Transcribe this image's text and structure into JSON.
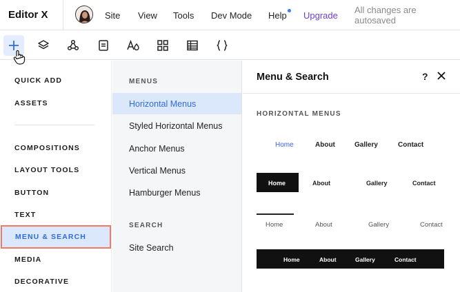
{
  "topbar": {
    "logo": "Editor X",
    "nav": [
      "Site",
      "View",
      "Tools",
      "Dev Mode",
      "Help"
    ],
    "upgrade": "Upgrade",
    "autosave_status": "All changes are autosaved"
  },
  "toolbar": {
    "tools": [
      "add-icon",
      "layers-icon",
      "components-icon",
      "pages-icon",
      "typography-icon",
      "apps-icon",
      "table-icon",
      "code-icon"
    ],
    "active_tool": "add-icon"
  },
  "categories": {
    "items": [
      "QUICK ADD",
      "ASSETS",
      "COMPOSITIONS",
      "LAYOUT TOOLS",
      "BUTTON",
      "TEXT",
      "MENU & SEARCH",
      "MEDIA",
      "DECORATIVE"
    ],
    "selected": "MENU & SEARCH"
  },
  "subcategories": {
    "menus_title": "MENUS",
    "menus": [
      "Horizontal Menus",
      "Styled Horizontal Menus",
      "Anchor Menus",
      "Vertical Menus",
      "Hamburger Menus"
    ],
    "selected": "Horizontal Menus",
    "search_title": "SEARCH",
    "search": [
      "Site Search"
    ]
  },
  "panel": {
    "title": "Menu & Search",
    "help": "?",
    "section_title": "HORIZONTAL MENUS",
    "menu_items": [
      "Home",
      "About",
      "Gallery",
      "Contact"
    ]
  },
  "colors": {
    "accent": "#2f6be0",
    "selection_bg": "#dbe7fb",
    "highlight_border": "#ef7a67",
    "upgrade": "#6a3fd9"
  }
}
